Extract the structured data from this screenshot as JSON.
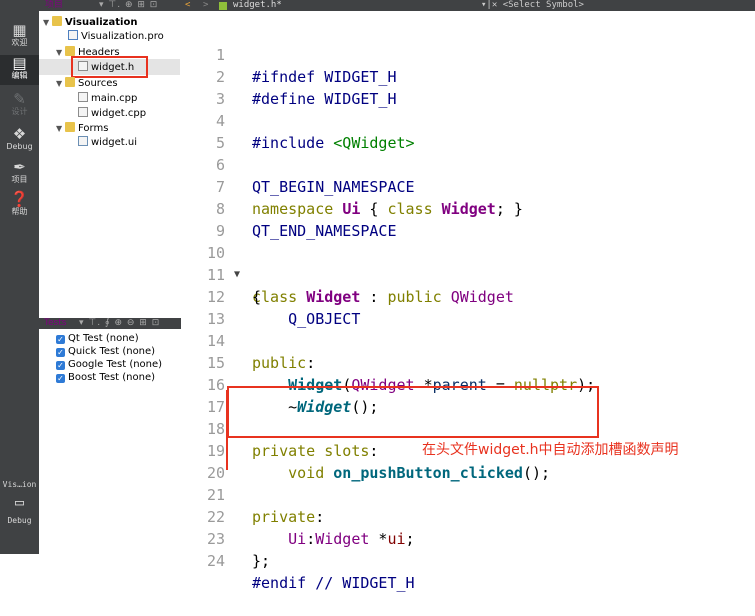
{
  "modes": [
    {
      "label": "欢迎",
      "icon": "grid-icon"
    },
    {
      "label": "编辑",
      "icon": "edit-icon",
      "active": true
    },
    {
      "label": "设计",
      "icon": "pencil-icon",
      "disabled": true
    },
    {
      "label": "Debug",
      "icon": "bug-icon"
    },
    {
      "label": "项目",
      "icon": "wrench-icon"
    },
    {
      "label": "帮助",
      "icon": "help-icon"
    }
  ],
  "kit": {
    "name": "Vis…ion",
    "label": "Debug"
  },
  "project_pane": {
    "title": "项目",
    "tree": {
      "root": "Visualization",
      "pro_file": "Visualization.pro",
      "headers": "Headers",
      "header_file": "widget.h",
      "sources": "Sources",
      "source_files": [
        "main.cpp",
        "widget.cpp"
      ],
      "forms": "Forms",
      "form_file": "widget.ui"
    }
  },
  "tests_pane": {
    "title": "Tests",
    "items": [
      "Qt Test (none)",
      "Quick Test (none)",
      "Google Test (none)",
      "Boost Test (none)"
    ]
  },
  "editor": {
    "tab_file": "widget.h*",
    "symbol_placeholder": "<Select Symbol>",
    "line_numbers": [
      "1",
      "2",
      "3",
      "4",
      "5",
      "6",
      "7",
      "8",
      "9",
      "10",
      "11",
      "12",
      "13",
      "14",
      "15",
      "16",
      "17",
      "18",
      "19",
      "20",
      "21",
      "22",
      "23",
      "24"
    ]
  },
  "code": {
    "l1": [
      "#ifndef WIDGET_H"
    ],
    "l2": [
      "#define WIDGET_H"
    ],
    "l4": [
      "#include ",
      "<QWidget>"
    ],
    "l6": [
      "QT_BEGIN_NAMESPACE"
    ],
    "l7": [
      "namespace ",
      "Ui",
      " { ",
      "class ",
      "Widget",
      "; }"
    ],
    "l8": [
      "QT_END_NAMESPACE"
    ],
    "l10": [
      "class ",
      "Widget",
      " : ",
      "public ",
      "QWidget"
    ],
    "l11": [
      "{"
    ],
    "l12": [
      "    Q_OBJECT"
    ],
    "l14": [
      "public",
      ":"
    ],
    "l15": [
      "    ",
      "Widget",
      "(",
      "QWidget",
      " *",
      "parent",
      " = ",
      "nullptr",
      ");"
    ],
    "l16": [
      "    ~",
      "Widget",
      "();"
    ],
    "l18": [
      "private slots",
      ":"
    ],
    "l19": [
      "    ",
      "void ",
      "on_pushButton_clicked",
      "();"
    ],
    "l21": [
      "private",
      ":"
    ],
    "l22": [
      "    ",
      "Ui",
      ":",
      "Widget",
      " *",
      "ui",
      ";"
    ],
    "l23": [
      "};"
    ],
    "l24": [
      "#endif // WIDGET_H"
    ]
  },
  "annotation": "在头文件widget.h中自动添加槽函数声明",
  "colors": {
    "highlight_box": "#e8321f",
    "keyword": "#808000",
    "preprocessor": "#000080",
    "type": "#800080",
    "string": "#008000"
  }
}
